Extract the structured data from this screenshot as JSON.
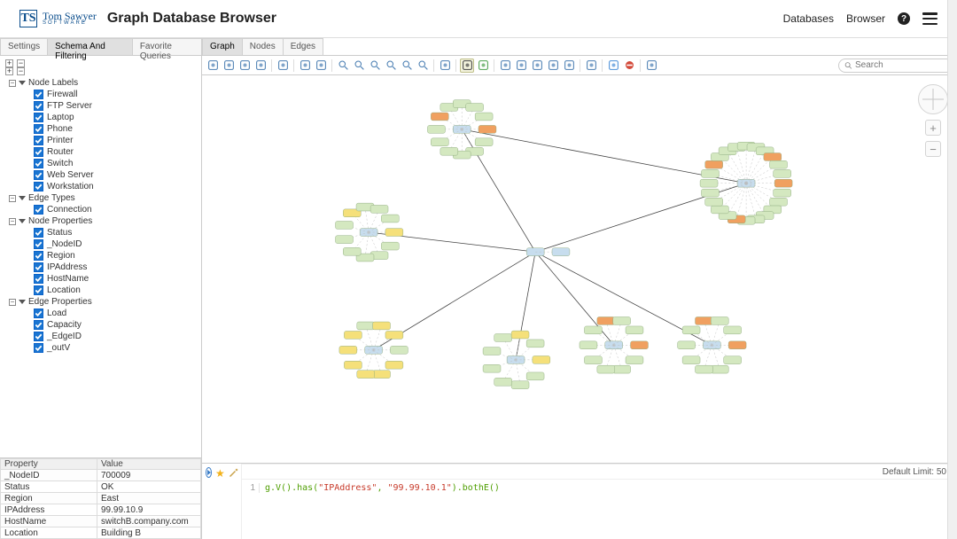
{
  "header": {
    "brand": "Tom Sawyer",
    "brand_sub": "SOFTWARE",
    "app_title": "Graph Database Browser",
    "link_databases": "Databases",
    "link_browser": "Browser",
    "help": "?"
  },
  "left_tabs": {
    "settings": "Settings",
    "schema": "Schema And Filtering",
    "favorites": "Favorite Queries"
  },
  "tree": {
    "node_labels_title": "Node Labels",
    "node_labels": [
      "Firewall",
      "FTP Server",
      "Laptop",
      "Phone",
      "Printer",
      "Router",
      "Switch",
      "Web Server",
      "Workstation"
    ],
    "edge_types_title": "Edge Types",
    "edge_types": [
      "Connection"
    ],
    "node_props_title": "Node Properties",
    "node_props": [
      "Status",
      "_NodeID",
      "Region",
      "IPAddress",
      "HostName",
      "Location"
    ],
    "edge_props_title": "Edge Properties",
    "edge_props": [
      "Load",
      "Capacity",
      "_EdgeID",
      "_outV"
    ]
  },
  "props_table": {
    "head_prop": "Property",
    "head_val": "Value",
    "rows": [
      {
        "p": "_NodeID",
        "v": "700009"
      },
      {
        "p": "Status",
        "v": "OK"
      },
      {
        "p": "Region",
        "v": "East"
      },
      {
        "p": "IPAddress",
        "v": "99.99.10.9"
      },
      {
        "p": "HostName",
        "v": "switchB.company.com"
      },
      {
        "p": "Location",
        "v": "Building B"
      }
    ]
  },
  "right_tabs": {
    "graph": "Graph",
    "nodes": "Nodes",
    "edges": "Edges"
  },
  "toolbar_icons": [
    "save-icon",
    "open-icon",
    "print-icon",
    "export-icon",
    "sep",
    "copy-icon",
    "sep",
    "undo-icon",
    "redo-icon",
    "sep",
    "zoom-in-icon",
    "zoom-out-icon",
    "zoom-fit-icon",
    "zoom-box-icon",
    "zoom-selection-icon",
    "zoom-reset-icon",
    "sep",
    "pan-icon",
    "sep",
    "pointer-icon",
    "auto-layout-icon",
    "sep",
    "layout-tree-icon",
    "layout-hier-icon",
    "layout-circular-icon",
    "layout-radial-icon",
    "layout-organic-icon",
    "sep",
    "expand-icon",
    "sep",
    "highlight-icon",
    "stop-icon",
    "sep",
    "filter-icon"
  ],
  "search": {
    "placeholder": "Search"
  },
  "map_controls": {
    "zoom_in": "+",
    "zoom_out": "−"
  },
  "query": {
    "default_limit_label": "Default Limit: ",
    "default_limit_value": "50",
    "line_no": "1",
    "code_pre": "g.V().has(",
    "code_arg1": "\"IPAddress\"",
    "code_comma": ", ",
    "code_arg2": "\"99.99.10.1\"",
    "code_post": ").bothE()"
  }
}
